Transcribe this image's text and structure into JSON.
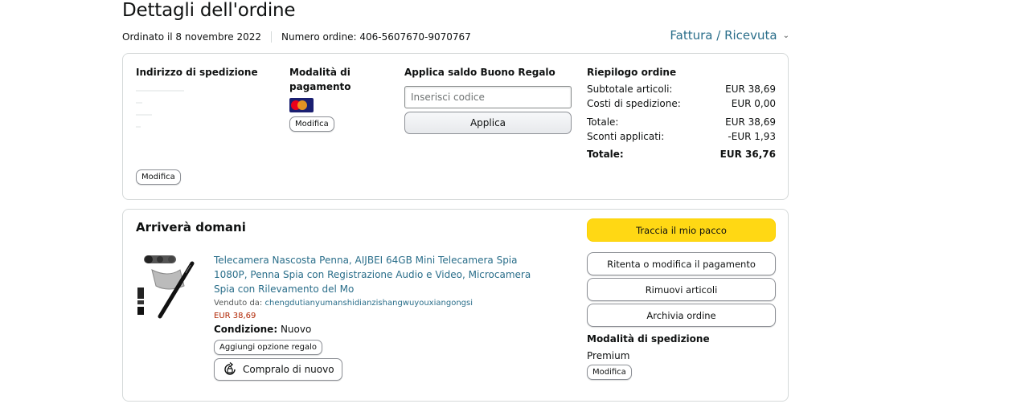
{
  "header": {
    "title": "Dettagli dell'ordine",
    "ordered": "Ordinato il 8 novembre 2022",
    "order_number": "Numero ordine: 406-5607670-9070767",
    "invoice_link": "Fattura / Ricevuta"
  },
  "shipping_address": {
    "title": "Indirizzo di spedizione",
    "edit": "Modifica"
  },
  "payment": {
    "title": "Modalità di pagamento",
    "card_icon": "mastercard-icon",
    "edit": "Modifica"
  },
  "gift_card": {
    "title": "Applica saldo Buono Regalo",
    "placeholder": "Inserisci codice",
    "apply": "Applica"
  },
  "summary": {
    "title": "Riepilogo ordine",
    "rows": [
      {
        "label": "Subtotale articoli:",
        "value": "EUR 38,69"
      },
      {
        "label": "Costi di spedizione:",
        "value": "EUR 0,00"
      },
      {
        "label": "Totale:",
        "value": "EUR 38,69"
      },
      {
        "label": "Sconti applicati:",
        "value": "-EUR 1,93"
      }
    ],
    "total_label": "Totale:",
    "total_value": "EUR 36,76"
  },
  "shipment": {
    "status": "Arriverà domani",
    "product": {
      "title": "Telecamera Nascosta Penna, AIJBEI 64GB Mini Telecamera Spia 1080P, Penna Spia con Registrazione Audio e Video, Microcamera Spia con Rilevamento del Mo",
      "seller_label": "Venduto da:",
      "seller": "chengdutianyumanshidianzishangwuyouxiangongsi",
      "price": "EUR 38,69",
      "condition_label": "Condizione:",
      "condition": "Nuovo",
      "gift_option": "Aggiungi opzione regalo",
      "buy_again": "Compralo di nuovo"
    },
    "actions": {
      "track": "Traccia il mio pacco",
      "retry_payment": "Ritenta o modifica il pagamento",
      "remove": "Rimuovi articoli",
      "archive": "Archivia ordine"
    },
    "shipping_method": {
      "title": "Modalità di spedizione",
      "value": "Premium",
      "edit": "Modifica"
    }
  },
  "colors": {
    "link": "#2A6E8A",
    "price": "#B12704",
    "primary_button": "#FFD814",
    "border": "#D5D9D9"
  }
}
